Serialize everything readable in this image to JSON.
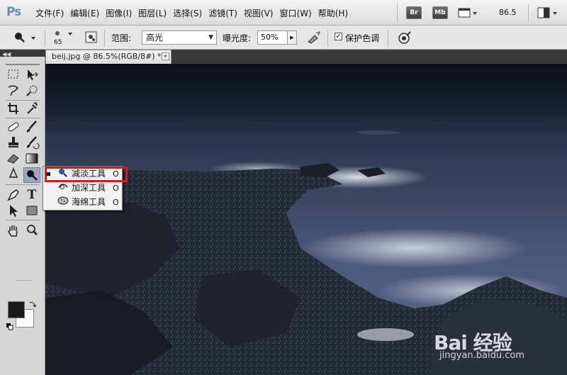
{
  "app": {
    "logo": "Ps"
  },
  "menu": [
    "文件(F)",
    "编辑(E)",
    "图像(I)",
    "图层(L)",
    "选择(S)",
    "滤镜(T)",
    "视图(V)",
    "窗口(W)",
    "帮助(H)"
  ],
  "app_bar": {
    "bridge": "Br",
    "mini_bridge": "Mb",
    "zoom": "86.5"
  },
  "options_bar": {
    "brush_size": "65",
    "range_label": "范围:",
    "range_value": "高光",
    "exposure_label": "曝光度:",
    "exposure_value": "50%",
    "protect_tones_label": "保护色调",
    "protect_tones_checked": true
  },
  "document": {
    "tab_title": "beij.jpg @ 86.5%(RGB/8#) *"
  },
  "flyout": {
    "items": [
      {
        "name": "减淡工具",
        "key": "O",
        "icon": "dodge-icon",
        "active": true
      },
      {
        "name": "加深工具",
        "key": "O",
        "icon": "burn-icon",
        "active": false
      },
      {
        "name": "海绵工具",
        "key": "O",
        "icon": "sponge-icon",
        "active": false
      }
    ]
  },
  "colors": {
    "foreground": "#1a1a1a",
    "background": "#ffffff",
    "highlight": "#e0161c"
  },
  "watermark": {
    "logo": "Bai 经验",
    "url": "jingyan.baidu.com"
  }
}
